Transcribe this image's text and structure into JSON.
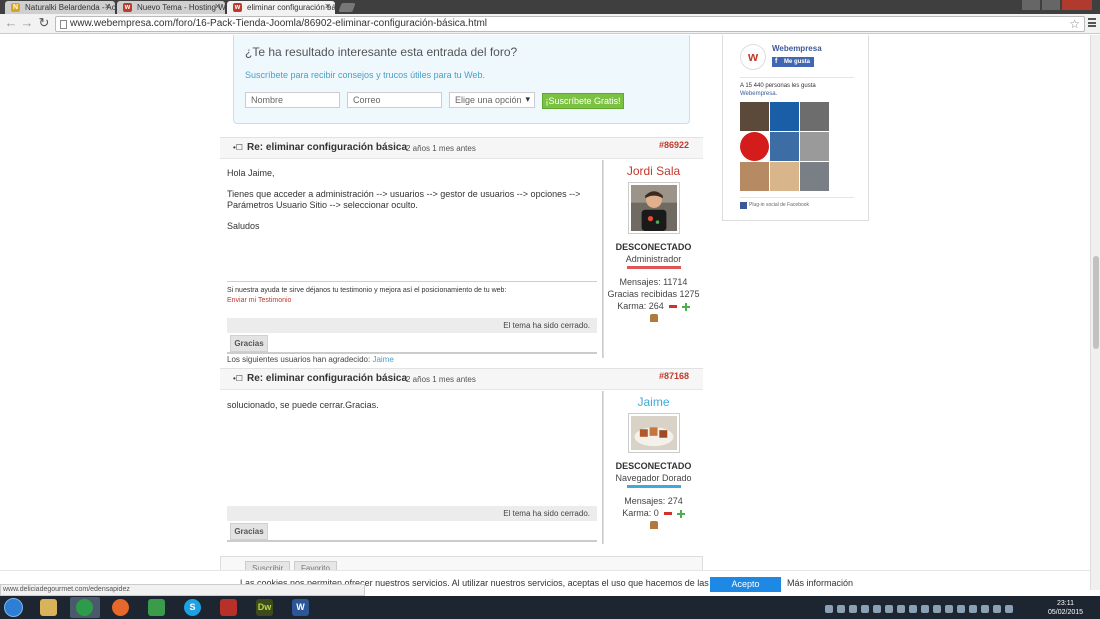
{
  "browser": {
    "tabs": [
      {
        "label": "Naturalki Belardenda - Ac",
        "active": false
      },
      {
        "label": "Nuevo Tema - Hosting W",
        "active": false
      },
      {
        "label": "eliminar configuración bá",
        "active": true
      }
    ],
    "url": "www.webempresa.com/foro/16-Pack-Tienda-Joomla/86902-eliminar-configuración-básica.html"
  },
  "subscribe": {
    "heading": "¿Te ha resultado interesante esta entrada del foro?",
    "text": "Suscríbete para recibir consejos y trucos útiles para tu Web.",
    "name_placeholder": "Nombre",
    "email_placeholder": "Correo",
    "select_value": "Elige una opción",
    "button": "¡Suscríbete Gratis!"
  },
  "posts": [
    {
      "title": "Re: eliminar configuración básica",
      "ago": "2 años 1 mes antes",
      "id": "#86922",
      "body": [
        "Hola Jaime,",
        "",
        "Tienes que acceder a administración --> usuarios --> gestor de usuarios --> opciones -->",
        "Parámetros Usuario Sitio --> seleccionar oculto.",
        "",
        "Saludos"
      ],
      "signature": "Si nuestra ayuda te sirve déjanos tu testimonio y mejora así el posicionamiento de tu web:",
      "signature_link": "Enviar mi Testimonio",
      "closed": "El tema ha sido cerrado.",
      "gracias": "Gracias",
      "thanks_prefix": "Los siguientes usuarios han agradecido:",
      "thanks_user": "Jaime",
      "author": {
        "name": "Jordi Sala",
        "status": "DESCONECTADO",
        "rank": "Administrador",
        "rank_color": "#e05555",
        "messages": "Mensajes: 11714",
        "thanks": "Gracias recibidas 1275",
        "karma": "Karma: 264"
      }
    },
    {
      "title": "Re: eliminar configuración básica",
      "ago": "2 años 1 mes antes",
      "id": "#87168",
      "body": [
        "solucionado, se puede cerrar.Gracias."
      ],
      "closed": "El tema ha sido cerrado.",
      "gracias": "Gracias",
      "author": {
        "name": "Jaime",
        "status": "DESCONECTADO",
        "rank": "Navegador Dorado",
        "rank_color": "#3fa9d8",
        "messages": "Mensajes: 274",
        "karma": "Karma: 0"
      }
    }
  ],
  "bottom": {
    "subscribe": "Suscribir",
    "favorite": "Favorito"
  },
  "facebook": {
    "page_name": "Webempresa",
    "like": "Me gusta",
    "count_text": "A 15 440 personas les gusta",
    "count_link": "Webempresa.",
    "plugin": "Plug-in social de Facebook"
  },
  "cookie": {
    "message": "Las cookies nos permiten ofrecer nuestros servicios. Al utilizar nuestros servicios, aceptas el uso que hacemos de las cookies",
    "accept": "Acepto",
    "more": "Más información"
  },
  "status_url": "www.deliciadegourmet.com/edensapidez",
  "clock": {
    "time": "23:11",
    "date": "05/02/2015"
  }
}
